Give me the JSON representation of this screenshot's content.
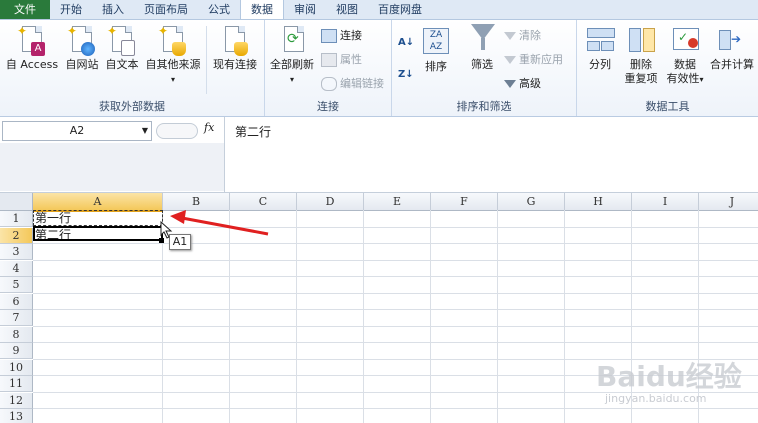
{
  "tabs": [
    "文件",
    "开始",
    "插入",
    "页面布局",
    "公式",
    "数据",
    "审阅",
    "视图",
    "百度网盘"
  ],
  "active_tab_index": 5,
  "ribbon": {
    "external_data": {
      "label": "获取外部数据",
      "access": "自 Access",
      "web": "自网站",
      "text": "自文本",
      "other": "自其他来源",
      "existing": "现有连接"
    },
    "connections": {
      "label": "连接",
      "refresh_all": "全部刷新",
      "connections": "连接",
      "properties": "属性",
      "edit_links": "编辑链接"
    },
    "sort_filter": {
      "label": "排序和筛选",
      "sort": "排序",
      "filter": "筛选",
      "clear": "清除",
      "reapply": "重新应用",
      "advanced": "高级"
    },
    "data_tools": {
      "label": "数据工具",
      "text_to_columns": "分列",
      "remove_dup_1": "删除",
      "remove_dup_2": "重复项",
      "validation_1": "数据",
      "validation_2": "有效性",
      "consolidate": "合并计算"
    }
  },
  "formula_bar": {
    "name_box": "A2",
    "fx": "fx",
    "formula": "第二行"
  },
  "grid": {
    "columns": [
      "A",
      "B",
      "C",
      "D",
      "E",
      "F",
      "G",
      "H",
      "I",
      "J"
    ],
    "rows": [
      "1",
      "2",
      "3",
      "4",
      "5",
      "6",
      "7",
      "8",
      "9",
      "10",
      "11",
      "12",
      "13"
    ],
    "cells": {
      "A1": "第一行",
      "A2": "第二行"
    },
    "tooltip": "A1"
  },
  "watermark": {
    "brand": "Baidu经验",
    "url": "jingyan.baidu.com"
  },
  "colors": {
    "file_tab": "#2a7a3b",
    "selection_header": "#f4c85a",
    "arrow": "#e02020"
  }
}
